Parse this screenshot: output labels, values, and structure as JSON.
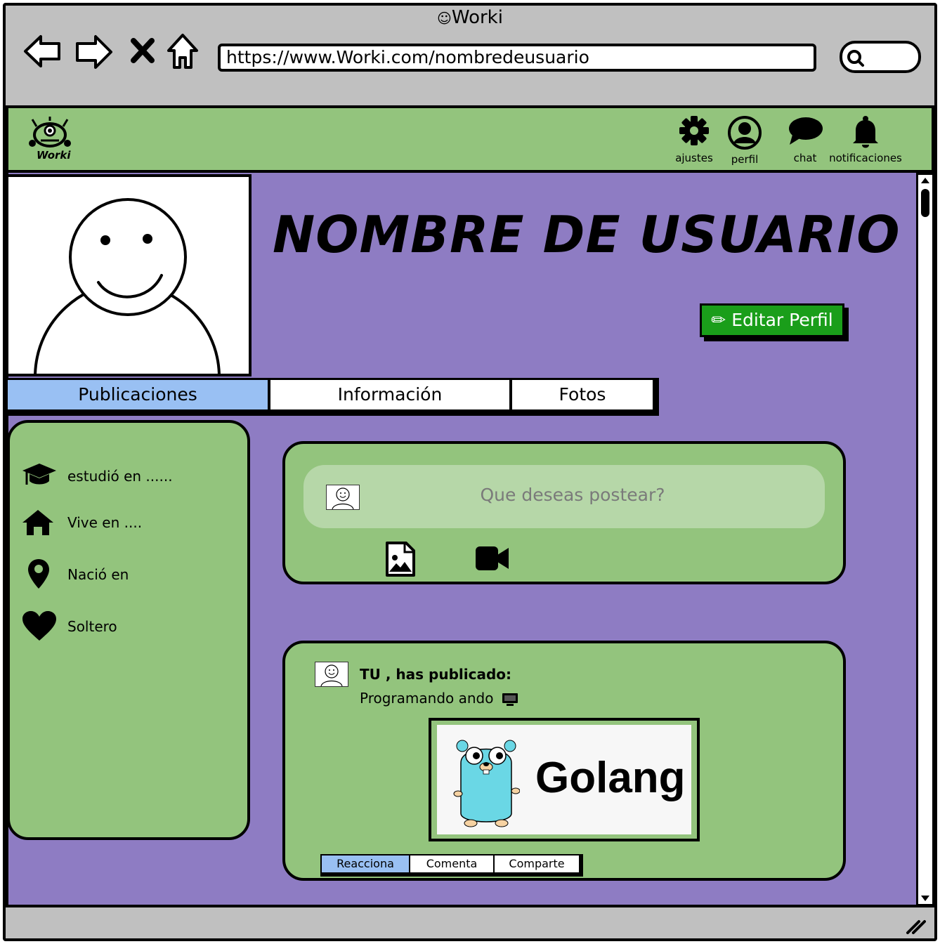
{
  "browser": {
    "title": "Worki",
    "url": "https://www.Worki.com/nombredeusuario"
  },
  "header": {
    "logo_text": "Worki",
    "items": [
      {
        "label": "ajustes",
        "icon": "gear-icon"
      },
      {
        "label": "perfil",
        "icon": "user-icon"
      },
      {
        "label": "chat",
        "icon": "chat-bubble-icon"
      },
      {
        "label": "notificaciones",
        "icon": "bell-icon"
      }
    ]
  },
  "profile": {
    "name": "NOMBRE DE USUARIO",
    "edit_button": "✏ Editar Perfil",
    "tabs": [
      {
        "label": "Publicaciones",
        "active": true
      },
      {
        "label": "Información",
        "active": false
      },
      {
        "label": "Fotos",
        "active": false
      }
    ]
  },
  "info": {
    "items": [
      {
        "icon": "graduation-cap-icon",
        "text": "estudió en ......"
      },
      {
        "icon": "home-icon",
        "text": "Vive en ...."
      },
      {
        "icon": "map-pin-icon",
        "text": "Nació en"
      },
      {
        "icon": "heart-icon",
        "text": "Soltero"
      }
    ]
  },
  "composer": {
    "placeholder": "Que deseas postear?"
  },
  "post": {
    "author_line": "TU , has publicado:",
    "text": "Programando ando",
    "image_text": "Golang",
    "actions": [
      {
        "label": "Reacciona",
        "active": true
      },
      {
        "label": "Comenta",
        "active": false
      },
      {
        "label": "Comparte",
        "active": false
      }
    ]
  },
  "colors": {
    "chrome": "#c0c0c0",
    "header_green": "#93c47d",
    "main_purple": "#8e7cc3",
    "composer_green": "#b6d7a8",
    "edit_button": "#1a9e1a",
    "active_tab": "#99c0f3",
    "gopher": "#6ad7e5"
  }
}
